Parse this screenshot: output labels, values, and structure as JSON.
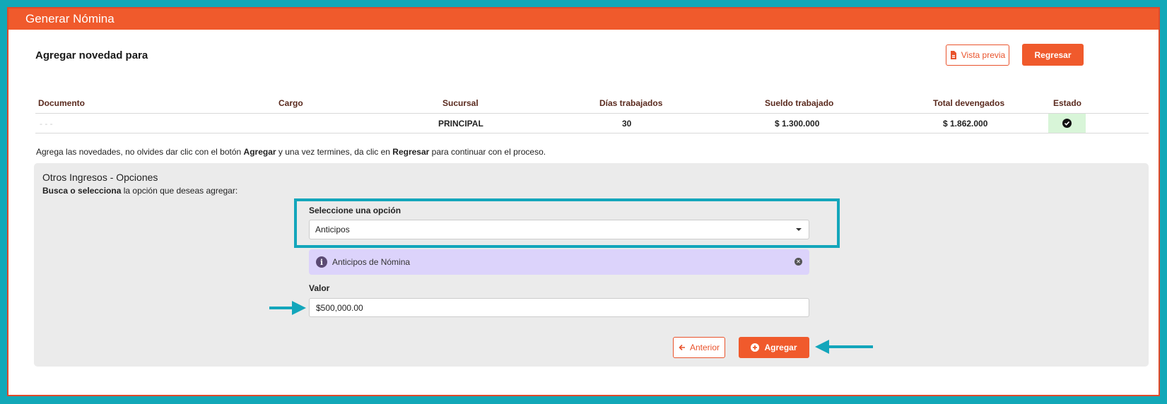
{
  "window": {
    "title": "Generar Nómina"
  },
  "header": {
    "title": "Agregar novedad para",
    "preview_label": "Vista previa",
    "back_label": "Regresar"
  },
  "table": {
    "columns": [
      "Documento",
      "Cargo",
      "Sucursal",
      "Días trabajados",
      "Sueldo trabajado",
      "Total devengados",
      "Estado"
    ],
    "row": {
      "documento": "- - -",
      "cargo": "",
      "sucursal": "PRINCIPAL",
      "dias": "30",
      "sueldo": "$ 1.300.000",
      "total": "$ 1.862.000"
    }
  },
  "hint": {
    "p1": "Agrega las novedades, no olvides dar clic con el botón ",
    "b1": "Agregar",
    "p2": " y una vez termines, da clic en ",
    "b2": "Regresar",
    "p3": " para continuar con el proceso."
  },
  "panel": {
    "title": "Otros Ingresos - Opciones",
    "sub_bold": "Busca o selecciona",
    "sub_rest": " la opción que deseas agregar:",
    "select_label": "Seleccione una opción",
    "select_value": "Anticipos",
    "info_text": "Anticipos de Nómina",
    "value_label": "Valor",
    "value_input": "$500,000.00",
    "prev_label": "Anterior",
    "add_label": "Agregar"
  },
  "colors": {
    "accent": "#f05a2c",
    "annotation": "#13a6bb",
    "status_ok_bg": "#d8f5d8",
    "info_bg": "#dcd3fb"
  }
}
